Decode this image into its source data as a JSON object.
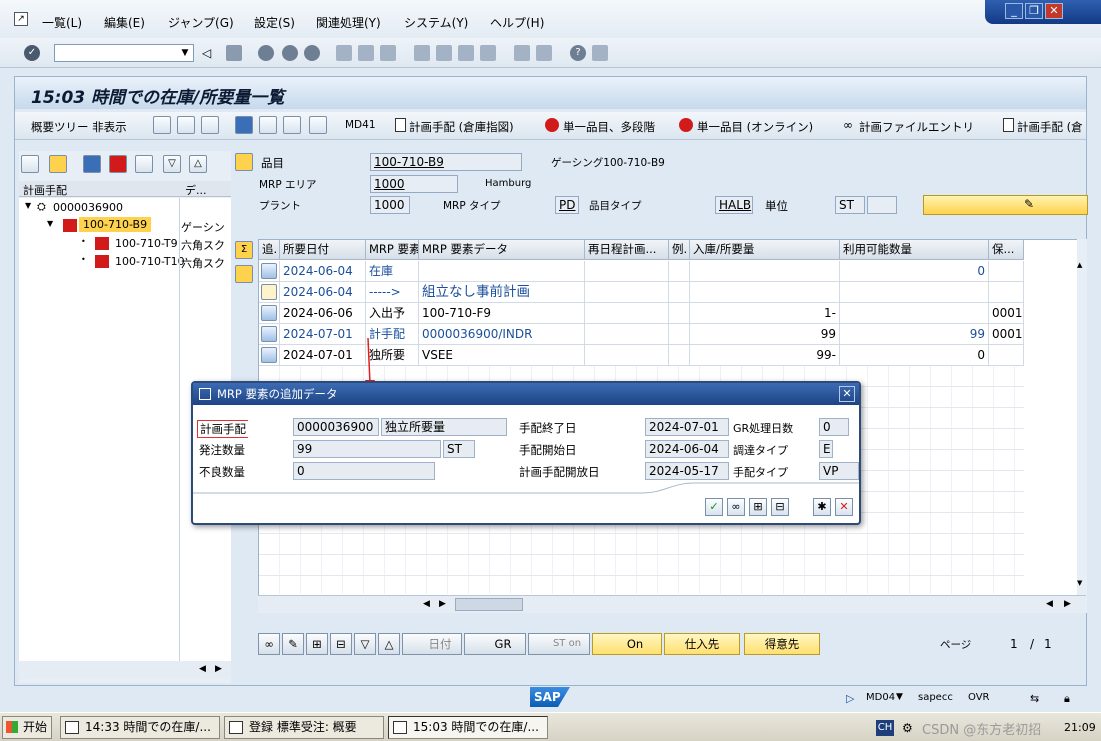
{
  "menu": {
    "items": [
      "一覧(L)",
      "編集(E)",
      "ジャンプ(G)",
      "設定(S)",
      "関連処理(Y)",
      "システム(Y)",
      "ヘルプ(H)"
    ]
  },
  "page": {
    "title": "15:03 時間での在庫/所要量一覧"
  },
  "app_toolbar": {
    "tree_toggle": "概要ツリー 非表示",
    "md41": "MD41",
    "plan_order_warehouse": "計画手配 (倉庫指図)",
    "single_item_multilevel": "単一品目、多段階",
    "single_item_online": "単一品目 (オンライン)",
    "plan_file_entry": "計画ファイルエントリ",
    "plan_order_2": "計画手配 (倉"
  },
  "tree": {
    "col1": "計画手配",
    "col2": "デ...",
    "rows": [
      {
        "label": "0000036900",
        "c2": ""
      },
      {
        "label": "100-710-B9",
        "c2": "ゲーシン"
      },
      {
        "label": "100-710-T9",
        "c2": "六角スク"
      },
      {
        "label": "100-710-T10",
        "c2": "六角スク"
      }
    ]
  },
  "header": {
    "material_label": "品目",
    "material": "100-710-B9",
    "material_desc": "ゲーシング100-710-B9",
    "mrp_area_label": "MRP エリア",
    "mrp_area": "1000",
    "mrp_area_desc": "Hamburg",
    "plant_label": "プラント",
    "plant": "1000",
    "mrp_type_label": "MRP タイプ",
    "mrp_type": "PD",
    "material_type_label": "品目タイプ",
    "material_type": "HALB",
    "unit_label": "単位",
    "unit": "ST"
  },
  "grid": {
    "columns": [
      "追.",
      "所要日付",
      "MRP 要素",
      "MRP 要素データ",
      "再日程計画...",
      "例.",
      "入庫/所要量",
      "利用可能数量",
      "保..."
    ],
    "rows": [
      {
        "date": "2024-06-04",
        "element": "在庫",
        "data": "",
        "resched": "",
        "exc": "",
        "qty": "",
        "avail": "0",
        "stor": "",
        "blue": true,
        "icon": true
      },
      {
        "date": "2024-06-04",
        "element": "----->",
        "data": "組立なし事前計画",
        "resched": "",
        "exc": "",
        "qty": "",
        "avail": "",
        "stor": "",
        "blue": true,
        "icon": false
      },
      {
        "date": "2024-06-06",
        "element": "入出予",
        "data": "100-710-F9",
        "resched": "",
        "exc": "",
        "qty": "1-",
        "avail": "",
        "stor": "0001",
        "blue": false,
        "icon": true
      },
      {
        "date": "2024-07-01",
        "element": "計手配",
        "data": "0000036900/INDR",
        "resched": "",
        "exc": "",
        "qty": "99",
        "avail": "99",
        "stor": "0001",
        "blue": true,
        "icon": true
      },
      {
        "date": "2024-07-01",
        "element": "独所要",
        "data": "VSEE",
        "resched": "",
        "exc": "",
        "qty": "99-",
        "avail": "0",
        "stor": "",
        "blue": false,
        "icon": true
      }
    ]
  },
  "bottom_toolbar": {
    "date_btn": "日付",
    "gr_btn": "GR",
    "st_on_btn": "ST on",
    "on_btn": "On",
    "vendor_btn": "仕入先",
    "customer_btn": "得意先",
    "page_label": "ページ",
    "page": "1",
    "slash": "/",
    "pages": "1"
  },
  "dialog": {
    "title": "MRP 要素の追加データ",
    "planned_order_label": "計画手配",
    "planned_order": "0000036900",
    "planned_order_type": "独立所要量",
    "order_qty_label": "発注数量",
    "order_qty": "99",
    "order_unit": "ST",
    "scrap_qty_label": "不良数量",
    "scrap_qty": "0",
    "finish_date_label": "手配終了日",
    "finish_date": "2024-07-01",
    "gr_days_label": "GR処理日数",
    "gr_days": "0",
    "start_date_label": "手配開始日",
    "start_date": "2024-06-04",
    "procurement_type_label": "調達タイプ",
    "procurement_type": "E",
    "opening_date_label": "計画手配開放日",
    "opening_date": "2024-05-17",
    "order_type_label": "手配タイプ",
    "order_type": "VP"
  },
  "status": {
    "sap_logo": "SAP",
    "tcode": "MD04",
    "server": "sapecc",
    "mode": "OVR"
  },
  "taskbar": {
    "start": "开始",
    "tasks": [
      "14:33 時間での在庫/...",
      "登録 標準受注: 概要",
      "15:03 時間での在庫/..."
    ],
    "ime": "CH",
    "watermark": "CSDN @东方老初招",
    "time": "21:09"
  },
  "colors": {
    "accent_blue": "#1a4f9c",
    "title_blue": "#1d4484",
    "highlight_yellow": "#ffd24d",
    "alert_red": "#d11a1a"
  }
}
